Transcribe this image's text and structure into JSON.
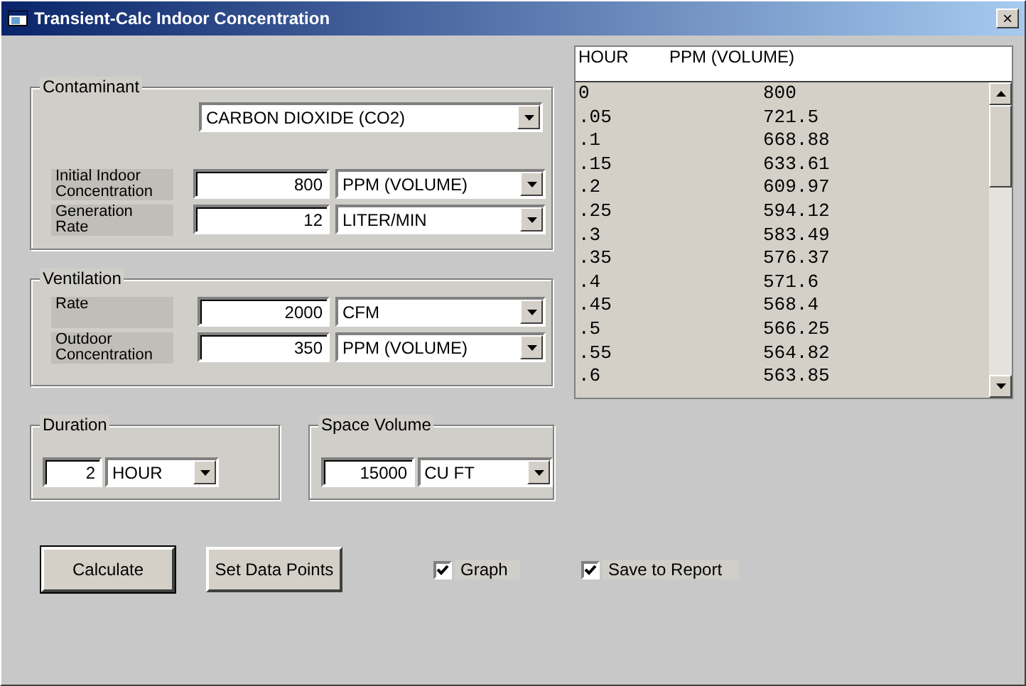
{
  "window": {
    "title": "Transient-Calc Indoor Concentration",
    "close_label": "×"
  },
  "contaminant": {
    "title": "Contaminant",
    "substance": "CARBON DIOXIDE (CO2)",
    "rows": [
      {
        "label": "Initial Indoor Concentration",
        "value": "800",
        "unit": "PPM (VOLUME)"
      },
      {
        "label": "Generation Rate",
        "value": "12",
        "unit": "LITER/MIN"
      }
    ]
  },
  "ventilation": {
    "title": "Ventilation",
    "rows": [
      {
        "label": "Rate",
        "value": "2000",
        "unit": "CFM"
      },
      {
        "label": "Outdoor Concentration",
        "value": "350",
        "unit": "PPM (VOLUME)"
      }
    ]
  },
  "duration": {
    "title": "Duration",
    "value": "2",
    "unit": "HOUR"
  },
  "space_volume": {
    "title": "Space Volume",
    "value": "15000",
    "unit": "CU FT"
  },
  "results": {
    "columns": [
      "HOUR",
      "PPM (VOLUME)"
    ],
    "rows": [
      [
        "0",
        "800"
      ],
      [
        ".05",
        "721.5"
      ],
      [
        ".1",
        "668.88"
      ],
      [
        ".15",
        "633.61"
      ],
      [
        ".2",
        "609.97"
      ],
      [
        ".25",
        "594.12"
      ],
      [
        ".3",
        "583.49"
      ],
      [
        ".35",
        "576.37"
      ],
      [
        ".4",
        "571.6"
      ],
      [
        ".45",
        "568.4"
      ],
      [
        ".5",
        "566.25"
      ],
      [
        ".55",
        "564.82"
      ],
      [
        ".6",
        "563.85"
      ]
    ]
  },
  "buttons": [
    {
      "label": "Calculate",
      "selected": true
    },
    {
      "label": "Set Data Points",
      "selected": false
    }
  ],
  "checkboxes": [
    {
      "label": "Graph",
      "checked": true
    },
    {
      "label": "Save to Report",
      "checked": true
    }
  ]
}
